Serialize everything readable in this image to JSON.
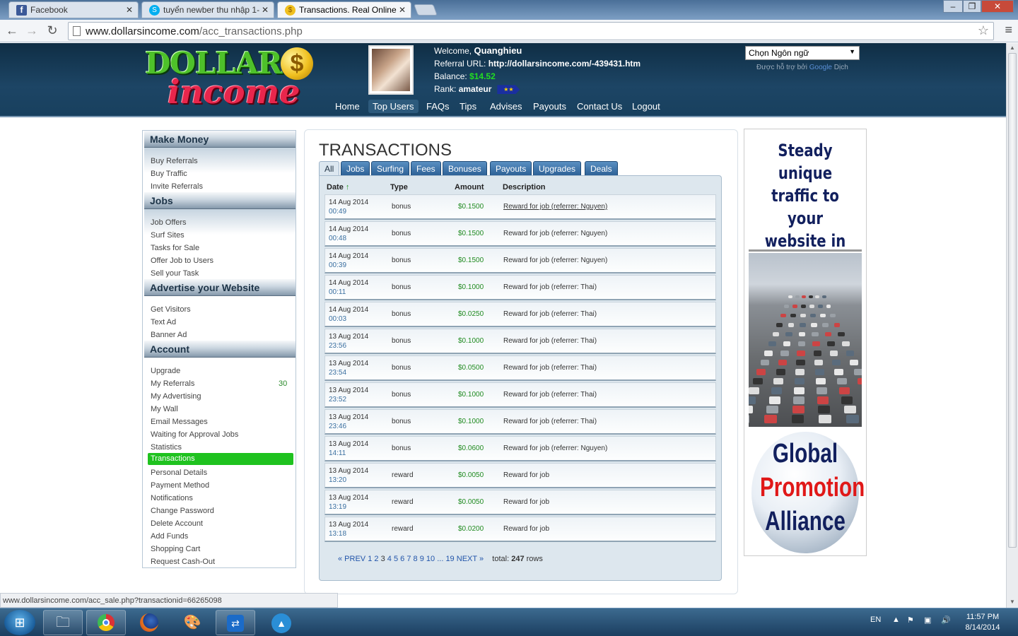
{
  "browser": {
    "tabs": [
      {
        "label": "Facebook",
        "active": false
      },
      {
        "label": "tuyển newber thu nhập 1-",
        "active": false
      },
      {
        "label": "Transactions. Real Online",
        "active": true
      }
    ],
    "url_domain": "www.dollarsincome.com",
    "url_path": "/acc_transactions.php",
    "status_url": "www.dollarsincome.com/acc_sale.php?transactionid=66265098"
  },
  "header": {
    "logo_line1": "DOLLAR",
    "logo_coin": "$",
    "logo_line2": "income",
    "welcome_label": "Welcome,",
    "username": "Quanghieu",
    "referral_label": "Referral URL:",
    "referral_url": "http://dollarsincome.com/-439431.htm",
    "balance_label": "Balance:",
    "balance_value": "$14.52",
    "balance_suffix": "52",
    "rank_label": "Rank:",
    "rank_value": "amateur",
    "rank_flag": "★★",
    "nav": [
      "Home",
      "Top Users",
      "FAQs",
      "Tips",
      "Advises",
      "Payouts",
      "Contact Us",
      "Logout"
    ],
    "language_select": "Chọn Ngôn ngữ",
    "translate_note_prefix": "Được hỗ trợ bởi",
    "translate_note_google": "Google",
    "translate_note_suffix": "Dịch"
  },
  "sidebar": {
    "sections": [
      {
        "title": "Make Money",
        "items": [
          "Buy Referrals",
          "Buy Traffic",
          "Invite Referrals"
        ]
      },
      {
        "title": "Jobs",
        "items": [
          "Job Offers",
          "Surf Sites",
          "Tasks for Sale",
          "Offer Job to Users",
          "Sell your Task"
        ]
      },
      {
        "title": "Advertise your Website",
        "items": [
          "Get Visitors",
          "Text Ad",
          "Banner Ad"
        ]
      },
      {
        "title": "Account",
        "items": [
          "Upgrade",
          "My Referrals",
          "My Advertising",
          "My Wall",
          "Email Messages",
          "Waiting for Approval Jobs",
          "Statistics",
          "Transactions",
          "Personal Details",
          "Payment Method",
          "Notifications",
          "Change Password",
          "Delete Account",
          "Add Funds",
          "Shopping Cart",
          "Request Cash-Out"
        ]
      }
    ],
    "referrals_count": "30",
    "active_item": "Transactions"
  },
  "main": {
    "title": "TRANSACTIONS",
    "filter_tabs": [
      "All",
      "Jobs",
      "Surfing",
      "Fees",
      "Bonuses",
      "Payouts",
      "Upgrades",
      "Deals"
    ],
    "columns": [
      "Date",
      "Type",
      "Amount",
      "Description"
    ],
    "sort_indicator": "↑",
    "rows": [
      {
        "date": "14 Aug 2014",
        "time": "00:49",
        "type": "bonus",
        "amount": "$0.1500",
        "description": "Reward for job (referrer: Nguyen)",
        "link": true
      },
      {
        "date": "14 Aug 2014",
        "time": "00:48",
        "type": "bonus",
        "amount": "$0.1500",
        "description": "Reward for job (referrer: Nguyen)",
        "link": false
      },
      {
        "date": "14 Aug 2014",
        "time": "00:39",
        "type": "bonus",
        "amount": "$0.1500",
        "description": "Reward for job (referrer: Nguyen)",
        "link": false
      },
      {
        "date": "14 Aug 2014",
        "time": "00:11",
        "type": "bonus",
        "amount": "$0.1000",
        "description": "Reward for job (referrer: Thai)",
        "link": false
      },
      {
        "date": "14 Aug 2014",
        "time": "00:03",
        "type": "bonus",
        "amount": "$0.0250",
        "description": "Reward for job (referrer: Thai)",
        "link": false
      },
      {
        "date": "13 Aug 2014",
        "time": "23:56",
        "type": "bonus",
        "amount": "$0.1000",
        "description": "Reward for job (referrer: Thai)",
        "link": false
      },
      {
        "date": "13 Aug 2014",
        "time": "23:54",
        "type": "bonus",
        "amount": "$0.0500",
        "description": "Reward for job (referrer: Thai)",
        "link": false
      },
      {
        "date": "13 Aug 2014",
        "time": "23:52",
        "type": "bonus",
        "amount": "$0.1000",
        "description": "Reward for job (referrer: Thai)",
        "link": false
      },
      {
        "date": "13 Aug 2014",
        "time": "23:46",
        "type": "bonus",
        "amount": "$0.1000",
        "description": "Reward for job (referrer: Thai)",
        "link": false
      },
      {
        "date": "13 Aug 2014",
        "time": "14:11",
        "type": "bonus",
        "amount": "$0.0600",
        "description": "Reward for job (referrer: Nguyen)",
        "link": false
      },
      {
        "date": "13 Aug 2014",
        "time": "13:20",
        "type": "reward",
        "amount": "$0.0050",
        "description": "Reward for job",
        "link": false
      },
      {
        "date": "13 Aug 2014",
        "time": "13:19",
        "type": "reward",
        "amount": "$0.0050",
        "description": "Reward for job",
        "link": false
      },
      {
        "date": "13 Aug 2014",
        "time": "13:18",
        "type": "reward",
        "amount": "$0.0200",
        "description": "Reward for job",
        "link": false
      }
    ],
    "pager": {
      "prev": "« PREV",
      "pages": [
        "1",
        "2",
        "3",
        "4",
        "5",
        "6",
        "7",
        "8",
        "9",
        "10"
      ],
      "current": "3",
      "ellipsis": "...",
      "last": "19",
      "next": "NEXT »",
      "total_label": "total:",
      "total_value": "247",
      "total_suffix": "rows"
    }
  },
  "ad": {
    "headline": "Steady unique traffic to your website in just a few hours",
    "line1": "Global",
    "line2": "Promotion",
    "line3": "Alliance"
  },
  "taskbar": {
    "lang": "EN",
    "time": "11:57 PM",
    "date": "8/14/2014"
  },
  "colors": {
    "header_bg": "#1d4565",
    "active_green": "#1fc21f",
    "tab_blue": "#2b5f94",
    "amount_green": "#1f8a1f"
  }
}
